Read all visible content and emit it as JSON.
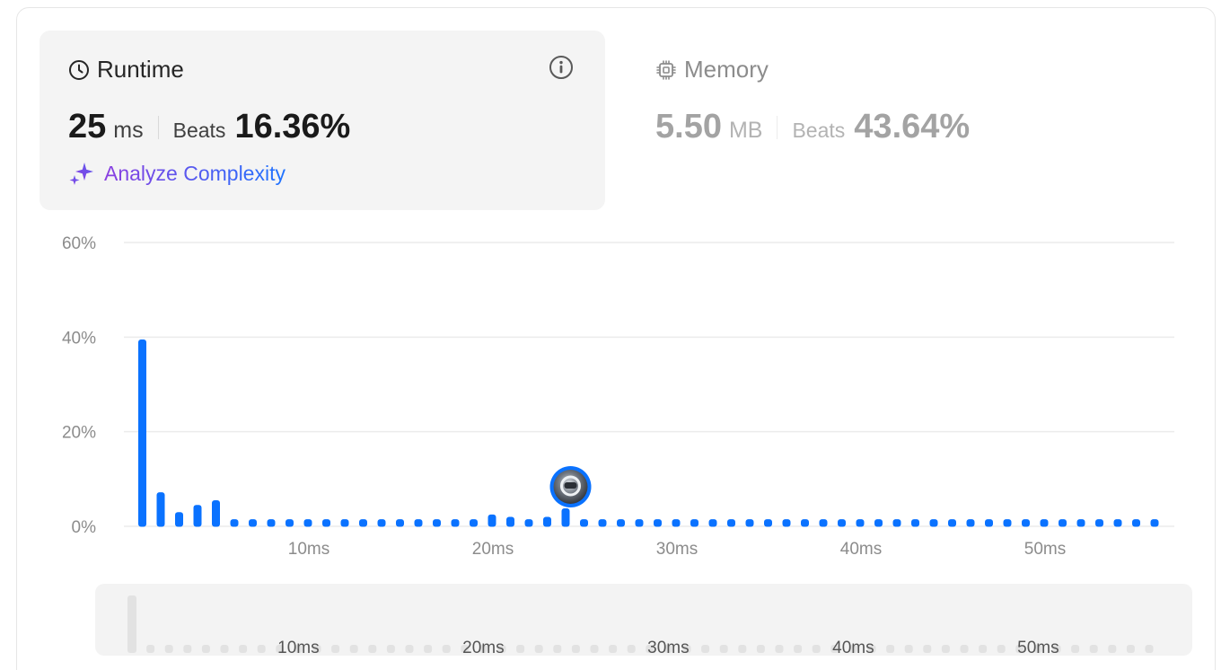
{
  "runtime": {
    "title": "Runtime",
    "value": "25",
    "unit": "ms",
    "beats_label": "Beats",
    "beats_percent": "16.36%",
    "analyze_label": "Analyze Complexity"
  },
  "memory": {
    "title": "Memory",
    "value": "5.50",
    "unit": "MB",
    "beats_label": "Beats",
    "beats_percent": "43.64%"
  },
  "icons": {
    "runtime": "clock-icon",
    "info": "info-icon",
    "analyze": "sparkle-icon",
    "memory": "chip-icon",
    "marker": "avatar"
  },
  "colors": {
    "bar": "#0a72ff",
    "minimap_bar": "#e2e2e2",
    "accent_purple": "#8b3fe0",
    "accent_blue": "#1f74ff"
  },
  "chart_data": {
    "type": "bar",
    "ylabel": "",
    "xlabel": "",
    "y_ticks": [
      "60%",
      "40%",
      "20%",
      "0%"
    ],
    "y_tick_values": [
      60,
      40,
      20,
      0
    ],
    "ylim": [
      0,
      60
    ],
    "x_tick_labels": [
      "10ms",
      "20ms",
      "30ms",
      "40ms",
      "50ms"
    ],
    "x_tick_values": [
      10,
      20,
      30,
      40,
      50
    ],
    "xlim": [
      0,
      56
    ],
    "grid": true,
    "x": [
      1,
      2,
      3,
      4,
      5,
      6,
      7,
      8,
      9,
      10,
      11,
      12,
      13,
      14,
      15,
      16,
      17,
      18,
      19,
      20,
      21,
      22,
      23,
      24,
      25,
      26,
      27,
      28,
      29,
      30,
      31,
      32,
      33,
      34,
      35,
      36,
      37,
      38,
      39,
      40,
      41,
      42,
      43,
      44,
      45,
      46,
      47,
      48,
      49,
      50,
      51,
      52,
      53,
      54,
      55,
      56
    ],
    "values": [
      39.5,
      7.2,
      3.0,
      4.5,
      5.5,
      1.5,
      1.5,
      1.5,
      1.5,
      1.5,
      1.5,
      1.5,
      1.5,
      1.5,
      1.5,
      1.5,
      1.5,
      1.5,
      1.5,
      2.5,
      2.0,
      1.5,
      2.0,
      3.8,
      1.5,
      1.5,
      1.5,
      1.5,
      1.5,
      1.5,
      1.5,
      1.5,
      1.5,
      1.5,
      1.5,
      1.5,
      1.5,
      1.5,
      1.5,
      1.5,
      1.5,
      1.5,
      1.5,
      1.5,
      1.5,
      1.5,
      1.5,
      1.5,
      1.5,
      1.5,
      1.5,
      1.5,
      1.5,
      1.5,
      1.5,
      1.5
    ],
    "marker_x": 25,
    "minimap_x_tick_labels": [
      "10ms",
      "20ms",
      "30ms",
      "40ms",
      "50ms"
    ]
  }
}
